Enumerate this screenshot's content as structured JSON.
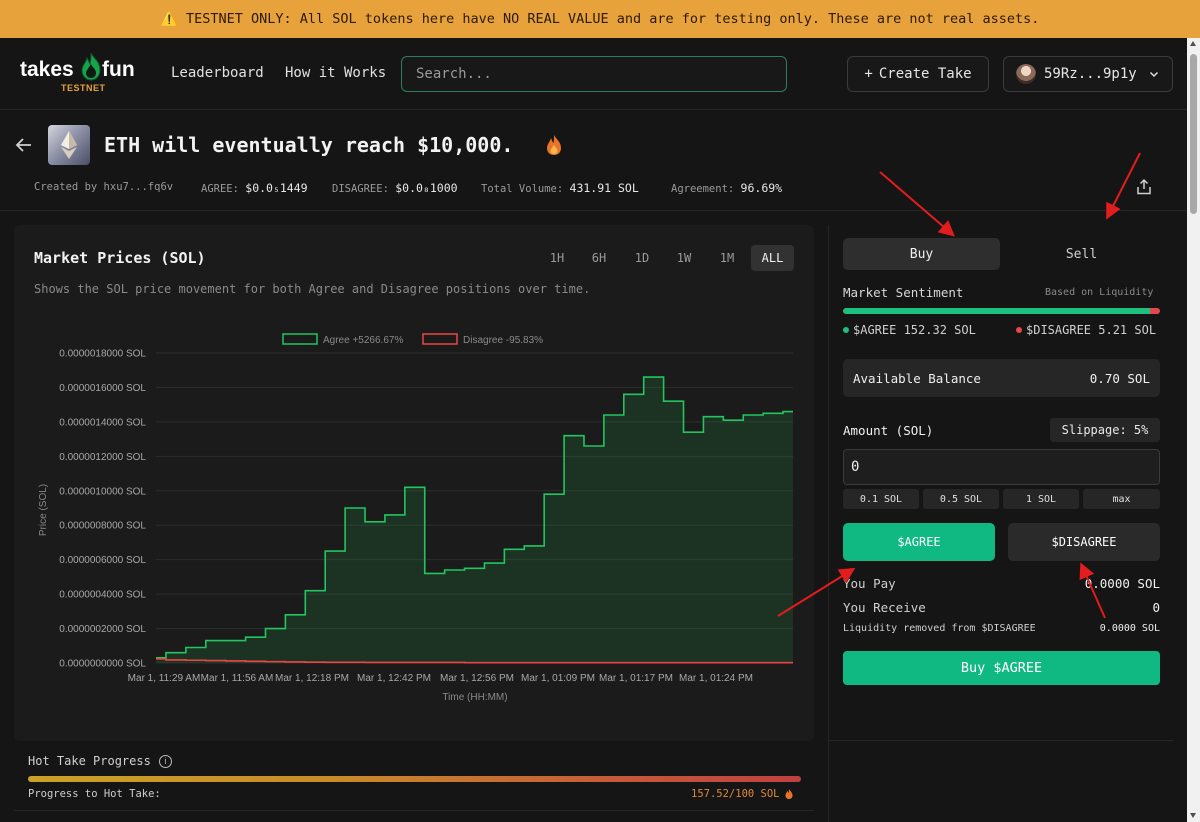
{
  "banner": {
    "text": "TESTNET ONLY: All SOL tokens here have NO REAL VALUE and are for testing only. These are not real assets."
  },
  "header": {
    "logo_left": "takes",
    "logo_right": "fun",
    "logo_badge": "TESTNET",
    "nav": {
      "leaderboard": "Leaderboard",
      "how": "How it Works"
    },
    "search_placeholder": "Search...",
    "create_label": "Create Take",
    "wallet_label": "59Rz...9p1y"
  },
  "take": {
    "title": "ETH will eventually reach $10,000.",
    "created_label": "Created by",
    "created_by": "hxu7...fq6v",
    "agree_label": "AGREE:",
    "agree_price": "$0.0₅1449",
    "disagree_label": "DISAGREE:",
    "disagree_price": "$0.0₈1000",
    "volume_label": "Total Volume:",
    "volume": "431.91 SOL",
    "agreement_label": "Agreement:",
    "agreement": "96.69%"
  },
  "chart_panel": {
    "title": "Market Prices (SOL)",
    "subtitle": "Shows the SOL price movement for both Agree and Disagree positions over time.",
    "timeframes": [
      "1H",
      "6H",
      "1D",
      "1W",
      "1M",
      "ALL"
    ],
    "active_timeframe": "ALL"
  },
  "chart_data": {
    "type": "line",
    "xlabel": "Time (HH:MM)",
    "ylabel": "Price (SOL)",
    "x_ticks": [
      "Mar 1, 11:29 AM",
      "Mar 1, 11:56 AM",
      "Mar 1, 12:18 PM",
      "Mar 1, 12:42 PM",
      "Mar 1, 12:56 PM",
      "Mar 1, 01:09 PM",
      "Mar 1, 01:17 PM",
      "Mar 1, 01:24 PM"
    ],
    "y_ticks": [
      "0.0000000000 SOL",
      "0.0000002000 SOL",
      "0.0000004000 SOL",
      "0.0000006000 SOL",
      "0.0000008000 SOL",
      "0.0000010000 SOL",
      "0.0000012000 SOL",
      "0.0000014000 SOL",
      "0.0000016000 SOL",
      "0.0000018000 SOL"
    ],
    "ylim": [
      0,
      1.8e-06
    ],
    "grid": true,
    "legend_position": "top-center",
    "series": [
      {
        "name": "Agree +5266.67%",
        "color": "#22c55e",
        "values": [
          3e-08,
          6e-08,
          9e-08,
          1.3e-07,
          1.3e-07,
          1.5e-07,
          2e-07,
          2.8e-07,
          4.2e-07,
          6.5e-07,
          9e-07,
          8.2e-07,
          8.6e-07,
          1.02e-06,
          5.2e-07,
          5.4e-07,
          5.5e-07,
          5.8e-07,
          6.6e-07,
          6.8e-07,
          9.8e-07,
          1.32e-06,
          1.26e-06,
          1.44e-06,
          1.56e-06,
          1.66e-06,
          1.52e-06,
          1.34e-06,
          1.43e-06,
          1.41e-06,
          1.44e-06,
          1.45e-06,
          1.46e-06
        ]
      },
      {
        "name": "Disagree -95.83%",
        "color": "#ef4444",
        "values": [
          2.4e-08,
          1.8e-08,
          1.6e-08,
          1.4e-08,
          1.2e-08,
          1e-08,
          8e-09,
          6e-09,
          5e-09,
          4e-09,
          4e-09,
          3e-09,
          3e-09,
          3e-09,
          3e-09,
          3e-09,
          2e-09,
          2e-09,
          2e-09,
          2e-09,
          2e-09,
          2e-09,
          2e-09,
          2e-09,
          2e-09,
          2e-09,
          2e-09,
          2e-09,
          2e-09,
          2e-09,
          2e-09,
          2e-09,
          2e-09
        ]
      }
    ]
  },
  "hot_take": {
    "label": "Hot Take Progress",
    "info_symbol": "i",
    "progress_label": "Progress to Hot Take:",
    "progress_value": "157.52/100 SOL",
    "progress_fraction": 1.0
  },
  "trade": {
    "tab_buy": "Buy",
    "tab_sell": "Sell",
    "sentiment_label": "Market Sentiment",
    "sentiment_note": "Based on Liquidity",
    "agree_text": "$AGREE 152.32 SOL",
    "disagree_text": "$DISAGREE 5.21 SOL",
    "agree_share": 0.9669,
    "balance_label": "Available Balance",
    "balance_value": "0.70 SOL",
    "amount_label": "Amount (SOL)",
    "slippage": "Slippage: 5%",
    "amount_value": "0",
    "quick": [
      "0.1 SOL",
      "0.5 SOL",
      "1 SOL",
      "max"
    ],
    "agree_btn": "$AGREE",
    "disagree_btn": "$DISAGREE",
    "pay_label": "You Pay",
    "pay_value": "0.0000 SOL",
    "receive_label": "You Receive",
    "receive_value": "0",
    "liq_label": "Liquidity removed from $DISAGREE",
    "liq_value": "0.0000 SOL",
    "buy_btn": "Buy $AGREE"
  },
  "colors": {
    "accent": "#10b981",
    "agree": "#22c55e",
    "disagree": "#ef4444",
    "banner": "#e8a23c"
  }
}
